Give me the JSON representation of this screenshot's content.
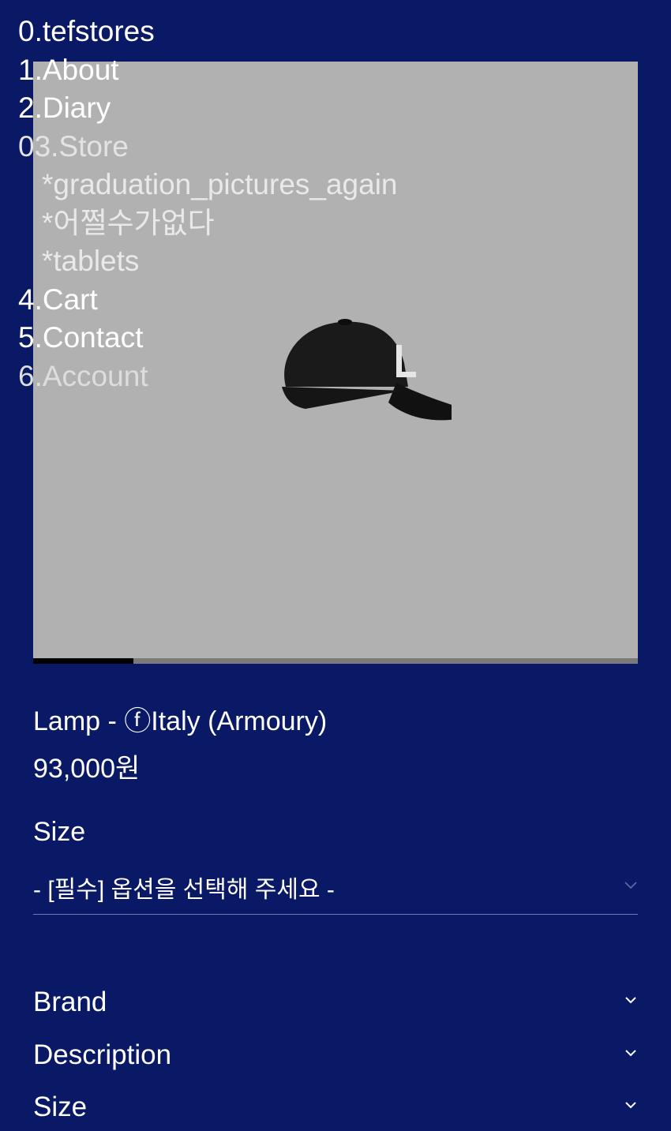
{
  "nav": {
    "items": [
      {
        "label": "0.tefstores"
      },
      {
        "label": "1.About"
      },
      {
        "label": "2.Diary"
      },
      {
        "label": "03.Store"
      },
      {
        "label": "4.Cart"
      },
      {
        "label": "5.Contact"
      },
      {
        "label": "6.Account"
      }
    ],
    "store_sub": [
      {
        "label": "*graduation_pictures_again"
      },
      {
        "label": "*어쩔수가없다"
      },
      {
        "label": "*tablets"
      }
    ]
  },
  "product": {
    "name": "Lamp - ⓕItaly (Armoury)",
    "price": "93,000원",
    "image_icon": "baseball-cap-image",
    "gallery_progress": 0.166
  },
  "option": {
    "label": "Size",
    "placeholder": "- [필수] 옵션을 선택해 주세요 -"
  },
  "accordion": [
    {
      "label": "Brand"
    },
    {
      "label": "Description"
    },
    {
      "label": "Size"
    }
  ],
  "colors": {
    "background": "#0a1966",
    "image_bg": "#b1b1b1",
    "text": "#ffffff"
  }
}
